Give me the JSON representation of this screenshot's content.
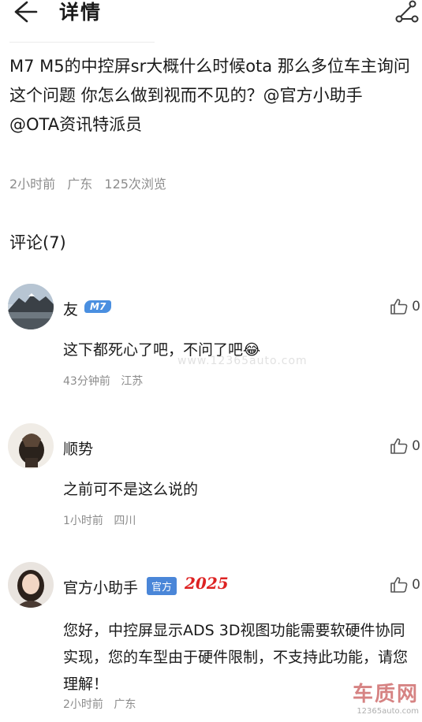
{
  "header": {
    "title": "详情",
    "back_icon": "arrow-left-icon",
    "share_icon": "share-icon"
  },
  "post": {
    "body": "M7 M5的中控屏sr大概什么时候ota 那么多位车主询问这个问题 你怎么做到视而不见的？@官方小助手 @OTA资讯特派员",
    "time": "2小时前",
    "location": "广东",
    "views": "125次浏览"
  },
  "comments_section": {
    "heading": "评论(7)"
  },
  "comments": [
    {
      "name": "友",
      "badge": "M7",
      "text": "这下都死心了吧，不问了吧😂",
      "time": "43分钟前",
      "location": "江苏",
      "likes": "0"
    },
    {
      "name": "顺势",
      "text": "之前可不是这么说的",
      "time": "1小时前",
      "location": "四川",
      "likes": "0"
    },
    {
      "name": "官方小助手",
      "badge": "官方",
      "badge_year": "2025",
      "text": "您好，中控屏显示ADS 3D视图功能需要软硬件协同实现，您的车型由于硬件限制，不支持此功能，请您理解！",
      "time": "2小时前",
      "location": "广东",
      "likes": "0"
    }
  ],
  "watermark": {
    "mid": "www.12365auto.com",
    "logo": "车质网",
    "logo_url": "12365auto.com"
  },
  "colors": {
    "badge_blue": "#4a8fe0",
    "year_red": "#dd2222",
    "meta_gray": "#8c8c8c"
  }
}
